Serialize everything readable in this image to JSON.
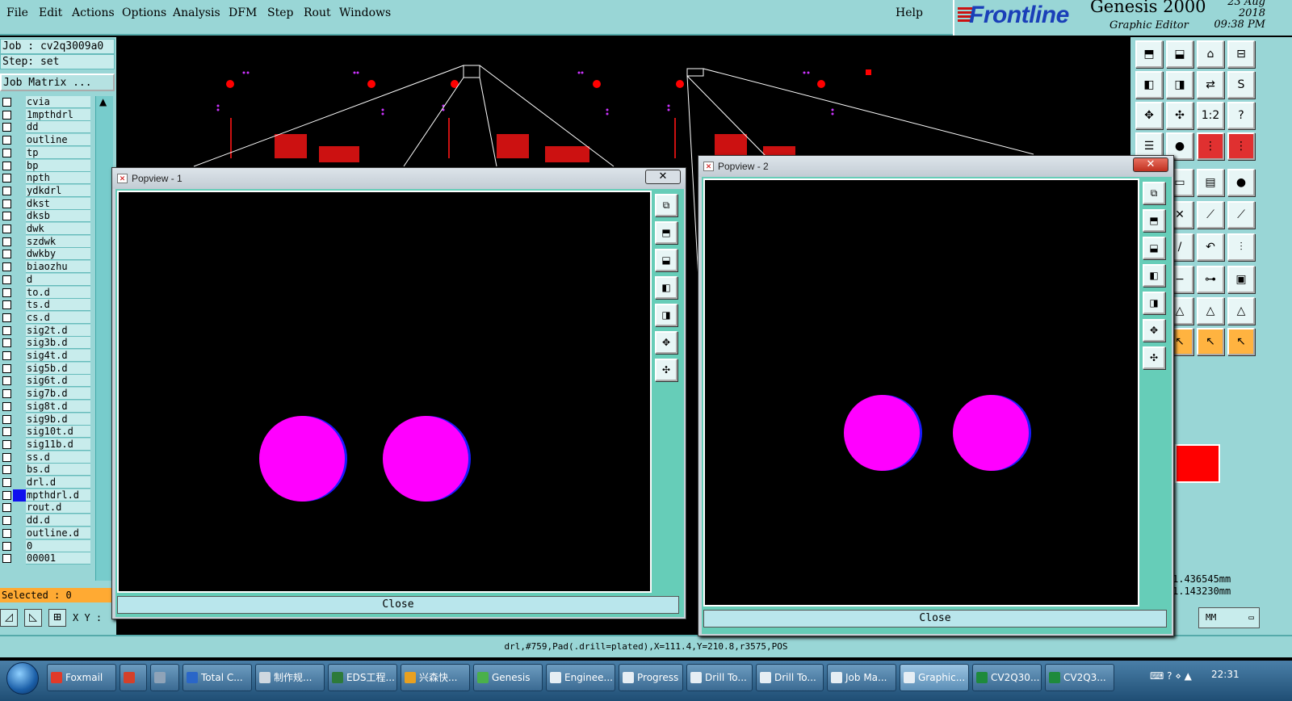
{
  "menu": {
    "items": [
      "File",
      "Edit",
      "Actions",
      "Options",
      "Analysis",
      "DFM",
      "Step",
      "Rout",
      "Windows"
    ],
    "help": "Help"
  },
  "branding": {
    "logo": "Frontline",
    "product": "Genesis 2000",
    "subtitle": "Graphic Editor",
    "date": "23 Aug 2018",
    "time": "09:38 PM"
  },
  "left_panel": {
    "job": "Job : cv2q3009a0",
    "step": "Step: set",
    "job_matrix": "Job Matrix ...",
    "layers": [
      "cvia",
      "1mpthdrl",
      "dd",
      "outline",
      "tp",
      "bp",
      "npth",
      "ydkdrl",
      "dkst",
      "dksb",
      "dwk",
      "szdwk",
      "dwkby",
      "biaozhu",
      "d",
      "to.d",
      "ts.d",
      "cs.d",
      "sig2t.d",
      "sig3b.d",
      "sig4t.d",
      "sig5b.d",
      "sig6t.d",
      "sig7b.d",
      "sig8t.d",
      "sig9b.d",
      "sig10t.d",
      "sig11b.d",
      "ss.d",
      "bs.d",
      "drl.d",
      "mpthdrl.d",
      "rout.d",
      "dd.d",
      "outline.d",
      "0",
      "00001"
    ],
    "active_layer_index": 31,
    "selected": "Selected : 0",
    "xy_label": "X Y :"
  },
  "coordinates": {
    "x": "1.436545mm",
    "y": "1.143230mm",
    "units": "MM"
  },
  "status_bar": "drl,#759,Pad(.drill=plated),X=111.4,Y=210.8,r3575,POS",
  "popview1": {
    "title": "Popview - 1",
    "close_x": "✕",
    "close_button": "Close"
  },
  "popview2": {
    "title": "Popview - 2",
    "close_x": "✕",
    "close_button": "Close"
  },
  "colors": {
    "panel": "#99d6d6",
    "pad": "#ff00ff",
    "pad_edge": "#1a1aff",
    "feature_red": "#ff0000",
    "highlight_orange": "#ffaa33"
  },
  "taskbar": {
    "items": [
      {
        "label": "Foxmail",
        "icon": "foxmail-icon"
      },
      {
        "label": "",
        "icon": "app-icon"
      },
      {
        "label": "",
        "icon": "calculator-icon"
      },
      {
        "label": "Total C...",
        "icon": "disk-icon"
      },
      {
        "label": "制作规...",
        "icon": "doc-icon"
      },
      {
        "label": "EDS工程...",
        "icon": "eds-icon"
      },
      {
        "label": "兴森快...",
        "icon": "star-icon"
      },
      {
        "label": "Genesis",
        "icon": "genesis-icon"
      },
      {
        "label": "Enginee...",
        "icon": "window-icon"
      },
      {
        "label": "Progress",
        "icon": "window-icon"
      },
      {
        "label": "Drill To...",
        "icon": "window-icon"
      },
      {
        "label": "Drill To...",
        "icon": "window-icon"
      },
      {
        "label": "Job Ma...",
        "icon": "window-icon"
      },
      {
        "label": "Graphic...",
        "icon": "window-icon"
      },
      {
        "label": "CV2Q30...",
        "icon": "excel-icon"
      },
      {
        "label": "CV2Q3...",
        "icon": "excel-icon"
      }
    ],
    "clock": "22:31"
  }
}
